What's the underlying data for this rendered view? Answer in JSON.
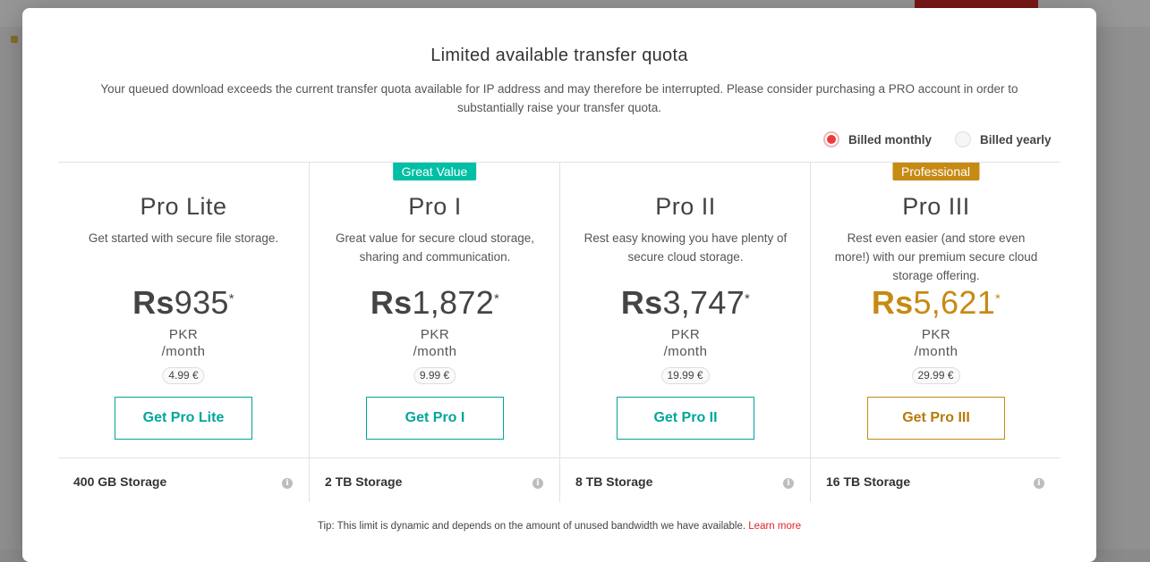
{
  "dialog": {
    "title": "Limited available transfer quota",
    "description": "Your queued download exceeds the current transfer quota available for IP address and may therefore be interrupted. Please consider purchasing a PRO account in order to substantially raise your transfer quota."
  },
  "billing": {
    "monthly_label": "Billed monthly",
    "yearly_label": "Billed yearly",
    "selected": "monthly"
  },
  "plans": [
    {
      "name": "Pro Lite",
      "badge": "",
      "description": "Get started with secure file storage.",
      "currency_symbol": "Rs",
      "price": "935",
      "asterisk": "*",
      "currency_code": "PKR",
      "period": "/month",
      "euro_price": "4.99 €",
      "button_label": "Get Pro Lite",
      "storage": "400 GB Storage"
    },
    {
      "name": "Pro I",
      "badge": "Great Value",
      "description": "Great value for secure cloud storage, sharing and communication.",
      "currency_symbol": "Rs",
      "price": "1,872",
      "asterisk": "*",
      "currency_code": "PKR",
      "period": "/month",
      "euro_price": "9.99 €",
      "button_label": "Get Pro I",
      "storage": "2 TB Storage"
    },
    {
      "name": "Pro II",
      "badge": "",
      "description": "Rest easy knowing you have plenty of secure cloud storage.",
      "currency_symbol": "Rs",
      "price": "3,747",
      "asterisk": "*",
      "currency_code": "PKR",
      "period": "/month",
      "euro_price": "19.99 €",
      "button_label": "Get Pro II",
      "storage": "8 TB Storage"
    },
    {
      "name": "Pro III",
      "badge": "Professional",
      "description": "Rest even easier (and store even more!) with our premium secure cloud storage offering.",
      "currency_symbol": "Rs",
      "price": "5,621",
      "asterisk": "*",
      "currency_code": "PKR",
      "period": "/month",
      "euro_price": "29.99 €",
      "button_label": "Get Pro III",
      "storage": "16 TB Storage"
    }
  ],
  "tip": {
    "text": "Tip: This limit is dynamic and depends on the amount of unused bandwidth we have available.",
    "link_label": "Learn more"
  },
  "colors": {
    "teal": "#00a69a",
    "gold": "#c78a13",
    "great_value_badge": "#00bfa5",
    "professional_badge": "#c78a13",
    "radio_selected": "#f0373a",
    "link": "#e0242a"
  },
  "icons": {
    "storage_info": "info-icon"
  }
}
